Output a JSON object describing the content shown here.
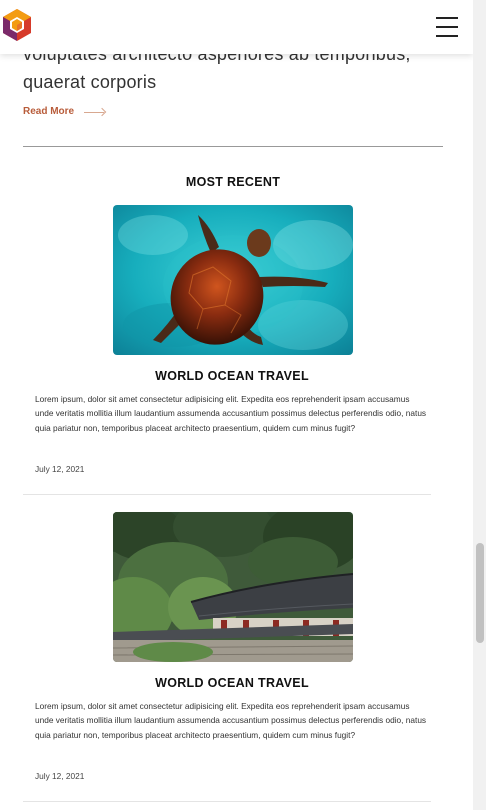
{
  "header": {
    "logo_name": "hexagon-logo",
    "menu_icon": "hamburger-menu-icon"
  },
  "previous_post": {
    "title_tail": "voluptates architecto asperiores ab temporibus, quaerat corporis",
    "read_more_label": "Read More"
  },
  "recent": {
    "section_title": "MOST RECENT",
    "posts": [
      {
        "title": "WORLD OCEAN TRAVEL",
        "excerpt": "Lorem ipsum, dolor sit amet consectetur adipisicing elit. Expedita eos reprehenderit ipsam accusamus unde veritatis mollitia illum laudantium assumenda accusantium possimus delectus perferendis odio, natus quia pariatur non, temporibus placeat architecto praesentium, quidem cum minus fugit?",
        "date": "July 12, 2021",
        "image": "sea-turtle-photo"
      },
      {
        "title": "WORLD OCEAN TRAVEL",
        "excerpt": "Lorem ipsum, dolor sit amet consectetur adipisicing elit. Expedita eos reprehenderit ipsam accusamus unde veritatis mollitia illum laudantium assumenda accusantium possimus delectus perferendis odio, natus quia pariatur non, temporibus placeat architecto praesentium, quidem cum minus fugit?",
        "date": "July 12, 2021",
        "image": "korean-temple-photo"
      }
    ]
  },
  "colors": {
    "accent": "#b85c3a",
    "logo_orange": "#f39c12",
    "logo_red": "#d63a2a",
    "logo_purple": "#7b2a6a"
  }
}
